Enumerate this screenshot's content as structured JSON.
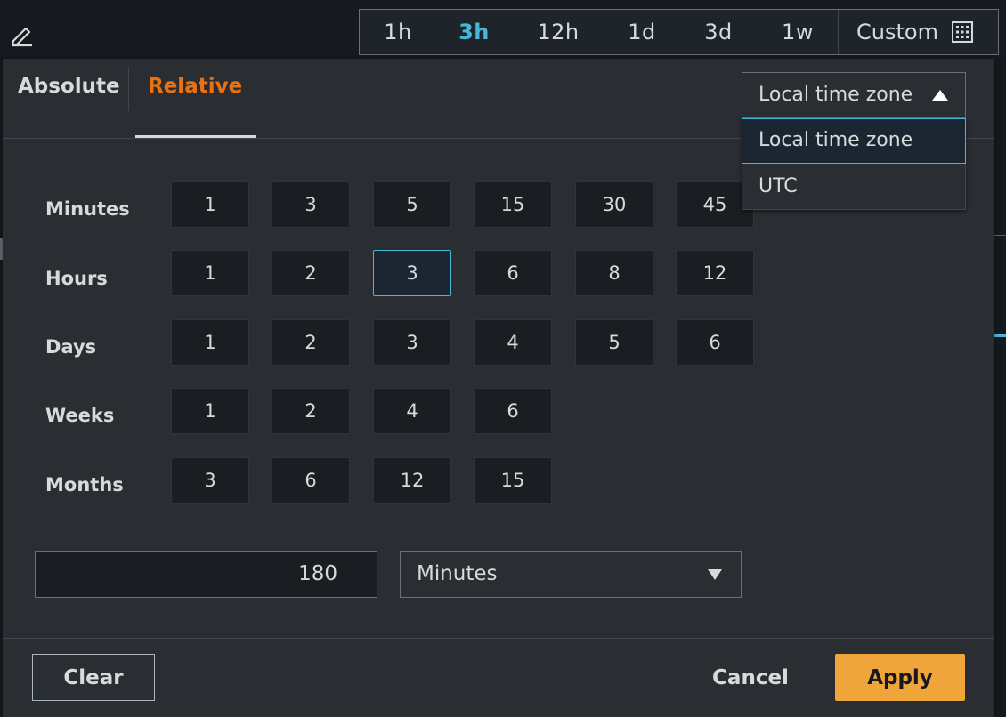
{
  "toolbar": {
    "ranges": [
      "1h",
      "3h",
      "12h",
      "1d",
      "3d",
      "1w"
    ],
    "active_range": "3h",
    "custom_label": "Custom"
  },
  "tabs": {
    "absolute": "Absolute",
    "relative": "Relative",
    "active": "Relative"
  },
  "timezone": {
    "selected": "Local time zone",
    "options": [
      "Local time zone",
      "UTC"
    ]
  },
  "quick_ranges": {
    "minutes": {
      "label": "Minutes",
      "values": [
        "1",
        "3",
        "5",
        "15",
        "30",
        "45"
      ]
    },
    "hours": {
      "label": "Hours",
      "values": [
        "1",
        "2",
        "3",
        "6",
        "8",
        "12"
      ],
      "selected": "3"
    },
    "days": {
      "label": "Days",
      "values": [
        "1",
        "2",
        "3",
        "4",
        "5",
        "6"
      ]
    },
    "weeks": {
      "label": "Weeks",
      "values": [
        "1",
        "2",
        "4",
        "6"
      ]
    },
    "months": {
      "label": "Months",
      "values": [
        "3",
        "6",
        "12",
        "15"
      ]
    }
  },
  "custom_duration": {
    "value": "180",
    "unit": "Minutes"
  },
  "footer": {
    "clear": "Clear",
    "cancel": "Cancel",
    "apply": "Apply"
  },
  "colors": {
    "accent_orange": "#ec7211",
    "active_blue": "#44b9d6",
    "apply_bg": "#f0a53a"
  }
}
